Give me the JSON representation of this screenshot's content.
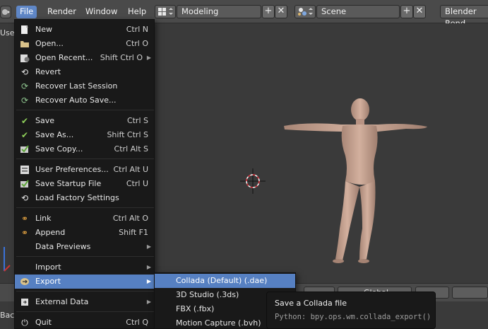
{
  "topbar": {
    "menus": [
      "File",
      "Render",
      "Window",
      "Help"
    ],
    "layout_name": "Modeling",
    "scene_name": "Scene",
    "render_engine": "Blender Rend"
  },
  "viewport": {
    "view_label": "Use",
    "bottom_left_label": "Back",
    "bottom_header_text": "Global"
  },
  "file_menu": {
    "items": [
      {
        "label": "New",
        "shortcut": "Ctrl N",
        "icon": "new-file-icon"
      },
      {
        "label": "Open...",
        "shortcut": "Ctrl O",
        "icon": "folder-open-icon"
      },
      {
        "label": "Open Recent...",
        "shortcut": "Shift Ctrl O",
        "icon": "open-recent-icon"
      },
      {
        "label": "Revert",
        "shortcut": "",
        "icon": "revert-icon"
      },
      {
        "label": "Recover Last Session",
        "shortcut": "",
        "icon": "recover-icon"
      },
      {
        "label": "Recover Auto Save...",
        "shortcut": "",
        "icon": "recover-autosave-icon"
      },
      {
        "label": "Save",
        "shortcut": "Ctrl S",
        "icon": "checkmark-icon"
      },
      {
        "label": "Save As...",
        "shortcut": "Shift Ctrl S",
        "icon": "checkmark-icon"
      },
      {
        "label": "Save Copy...",
        "shortcut": "Ctrl Alt S",
        "icon": "save-copy-icon"
      },
      {
        "label": "User Preferences...",
        "shortcut": "Ctrl Alt U",
        "icon": "preferences-icon"
      },
      {
        "label": "Save Startup File",
        "shortcut": "Ctrl U",
        "icon": "save-startup-icon"
      },
      {
        "label": "Load Factory Settings",
        "shortcut": "",
        "icon": "factory-settings-icon"
      },
      {
        "label": "Link",
        "shortcut": "Ctrl Alt O",
        "icon": "link-icon"
      },
      {
        "label": "Append",
        "shortcut": "Shift F1",
        "icon": "append-icon"
      },
      {
        "label": "Data Previews",
        "shortcut": "",
        "icon": ""
      },
      {
        "label": "Import",
        "shortcut": "",
        "icon": ""
      },
      {
        "label": "Export",
        "shortcut": "",
        "icon": "export-icon"
      },
      {
        "label": "External Data",
        "shortcut": "",
        "icon": "external-data-icon"
      },
      {
        "label": "Quit",
        "shortcut": "Ctrl Q",
        "icon": "power-icon"
      }
    ]
  },
  "export_submenu": {
    "items": [
      "Collada (Default) (.dae)",
      "3D Studio (.3ds)",
      "FBX (.fbx)",
      "Motion Capture (.bvh)"
    ]
  },
  "tooltip": {
    "title": "Save a Collada file",
    "python": "Python: bpy.ops.wm.collada_export()"
  },
  "colors": {
    "highlight": "#5680c2",
    "menu_bg": "#191919",
    "viewport_bg": "#3a3a3a",
    "figure_skin": "#c9a592"
  }
}
